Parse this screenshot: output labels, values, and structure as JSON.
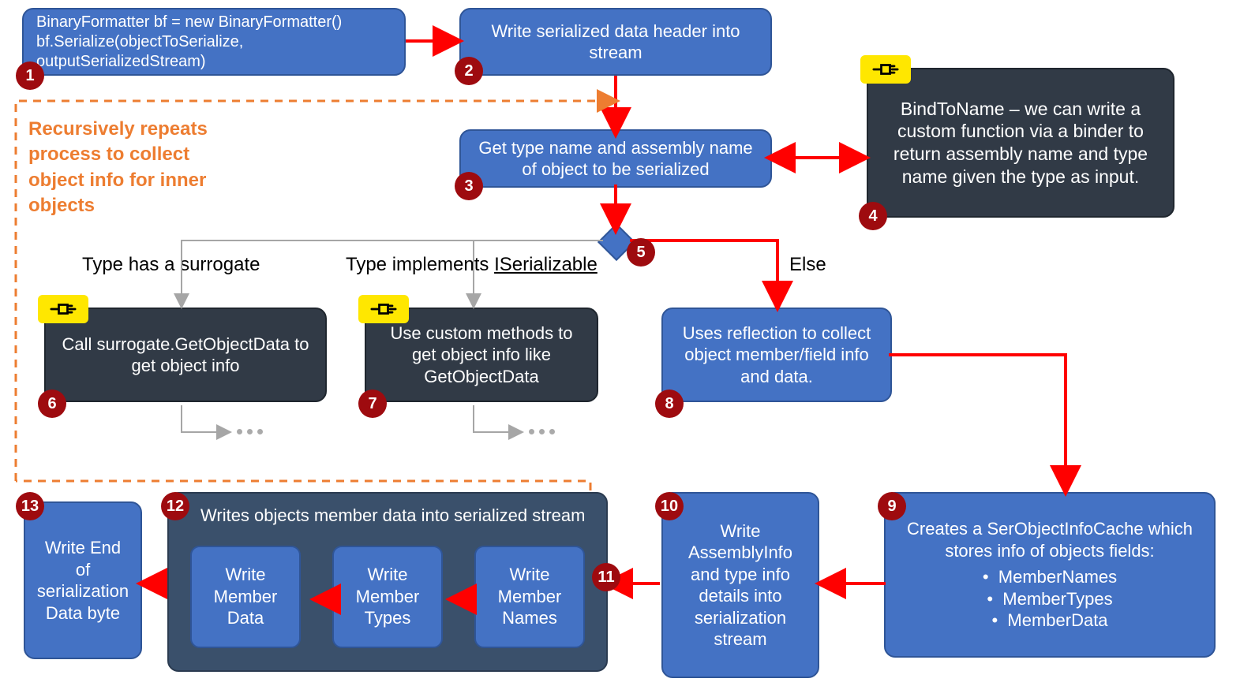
{
  "nodes": {
    "n1_line1": "BinaryFormatter bf = new BinaryFormatter()",
    "n1_line2": "bf.Serialize(objectToSerialize, outputSerializedStream)",
    "n2": "Write serialized data header into stream",
    "n3": "Get type name and assembly name of object to be serialized",
    "n4": "BindToName – we can write a custom function via a binder to return assembly name and type name given the type as input.",
    "n6": "Call surrogate.GetObjectData to get object info",
    "n7": "Use custom methods to get object info like GetObjectData",
    "n8": "Uses reflection to collect object member/field info and data.",
    "n9_title": "Creates a SerObjectInfoCache which stores info of objects fields:",
    "n9_b1": "MemberNames",
    "n9_b2": "MemberTypes",
    "n9_b3": "MemberData",
    "n10": "Write AssemblyInfo and type info details into serialization stream",
    "n12_title": "Writes objects member data into serialized stream",
    "n12_a": "Write Member Data",
    "n12_b": "Write Member Types",
    "n12_c": "Write Member Names",
    "n13": "Write End of serialization Data byte"
  },
  "labels": {
    "recurse": "Recursively repeats process to collect object info for inner objects",
    "branch_a": "Type has a surrogate",
    "branch_b_pre": "Type implements ",
    "branch_b_u": "ISerializable",
    "branch_c": "Else"
  },
  "badges": {
    "b1": "1",
    "b2": "2",
    "b3": "3",
    "b4": "4",
    "b5": "5",
    "b6": "6",
    "b7": "7",
    "b8": "8",
    "b9": "9",
    "b10": "10",
    "b11": "11",
    "b12": "12",
    "b13": "13"
  }
}
